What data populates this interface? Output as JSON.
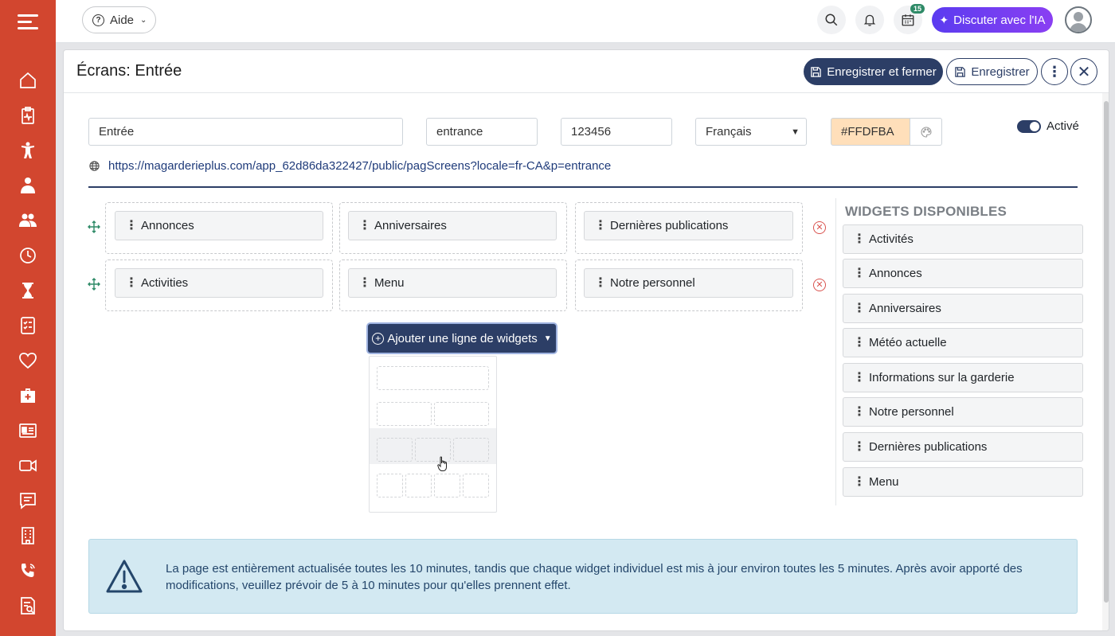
{
  "topbar": {
    "help_label": "Aide",
    "notification_badge": "15",
    "ai_button_label": "Discuter avec l'IA"
  },
  "sidebar": {
    "icons": [
      "home-icon",
      "clipboard-pulse-icon",
      "child-icon",
      "staff-icon",
      "group-icon",
      "clock-icon",
      "hourglass-icon",
      "checklist-icon",
      "heart-icon",
      "medical-kit-icon",
      "id-card-icon",
      "video-icon",
      "chat-icon",
      "building-icon",
      "phone-icon",
      "report-icon"
    ]
  },
  "modal": {
    "title": "Écrans: Entrée",
    "save_close_label": "Enregistrer et fermer",
    "save_label": "Enregistrer"
  },
  "form": {
    "name_value": "Entrée",
    "slug_value": "entrance",
    "code_value": "123456",
    "language_value": "Français",
    "color_value": "#FFDFBA",
    "active_label": "Activé",
    "active": true,
    "url": "https://magarderieplus.com/app_62d86da322427/public/pagScreens?locale=fr-CA&p=entrance"
  },
  "rows": [
    {
      "widgets": [
        "Annonces",
        "Anniversaires",
        "Dernières publications"
      ]
    },
    {
      "widgets": [
        "Activities",
        "Menu",
        "Notre personnel"
      ]
    }
  ],
  "add_row": {
    "button_label": "Ajouter une ligne de widgets",
    "layout_options": [
      1,
      2,
      3,
      4
    ],
    "hovered_option": 3
  },
  "available": {
    "title": "WIDGETS DISPONIBLES",
    "items": [
      "Activités",
      "Annonces",
      "Anniversaires",
      "Météo actuelle",
      "Informations sur la garderie",
      "Notre personnel",
      "Dernières publications",
      "Menu"
    ]
  },
  "alert": {
    "text": "La page est entièrement actualisée toutes les 10 minutes, tandis que chaque widget individuel est mis à jour environ toutes les 5 minutes. Après avoir apporté des modifications, veuillez prévoir de 5 à 10 minutes pour qu'elles prennent effet."
  },
  "colors": {
    "sidebar": "#d2462f",
    "primary": "#2c3e66",
    "ai_gradient_start": "#5b3cf0",
    "ai_gradient_end": "#8a3ff2",
    "row_handle": "#2e8a67",
    "remove": "#d9534f",
    "alert_bg": "#d3e9f2"
  }
}
